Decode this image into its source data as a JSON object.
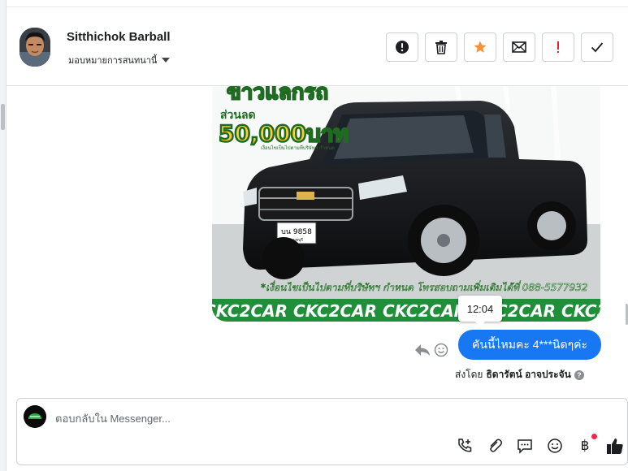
{
  "contact": {
    "name": "Sitthichok Barball",
    "assign_label": "มอบหมายการสนทนานี้"
  },
  "header_actions": [
    {
      "name": "spam-button",
      "icon": "exclamation-circle-icon"
    },
    {
      "name": "delete-button",
      "icon": "trash-icon"
    },
    {
      "name": "star-button",
      "icon": "star-icon",
      "color": "#f7923a"
    },
    {
      "name": "mark-unread-button",
      "icon": "envelope-icon"
    },
    {
      "name": "follow-up-button",
      "icon": "exclamation-icon",
      "color": "#e4202e"
    },
    {
      "name": "mark-done-button",
      "icon": "checkmark-icon"
    }
  ],
  "promo_image": {
    "headline": "ข้าวแลกรถ",
    "discount_label": "ส่วนลด",
    "discount_amount": "50,000บาท",
    "discount_note": "เงื่อนไขเป็นไปตามที่บริษัทฯ กำหนด",
    "plate": "บน 9858",
    "plate_province": "นนทบุรี",
    "footer_note": "*เงื่อนไขเป็นไปตามที่บริษัทฯ กำหนด โทรสอบถามเพิ่มเติมได้ที่ 088-5577932",
    "brand_band": "CKC2CAR CKC2CAR CKC2CAR CKC2CAR CKC2"
  },
  "message": {
    "time": "12:04",
    "text": "คันนี้ไหมคะ 4***นิดๆค่ะ",
    "sent_by_prefix": "ส่งโดย",
    "sent_by_name": "ธิดารัตน์ อาจประจัน",
    "help": "?"
  },
  "composer": {
    "placeholder": "ตอบกลับใน Messenger...",
    "baht_symbol": "฿"
  },
  "colors": {
    "accent": "#1877f2",
    "promo_green": "#1f8f3a",
    "star": "#f7923a",
    "alert": "#e4202e"
  }
}
